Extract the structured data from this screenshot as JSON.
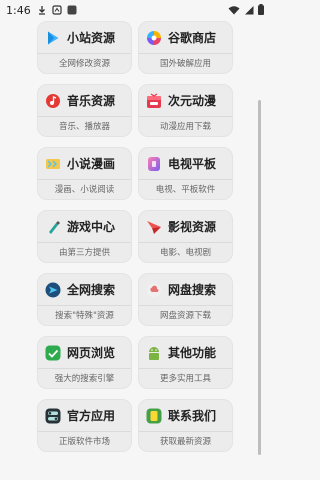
{
  "status_bar": {
    "time": "1:46"
  },
  "cards": [
    {
      "title": "小站资源",
      "sub": "全网修改资源",
      "icon": "play-store-icon",
      "color": "#3fb2ff"
    },
    {
      "title": "谷歌商店",
      "sub": "国外破解应用",
      "icon": "pinwheel-icon",
      "color": "#f0a030"
    },
    {
      "title": "音乐资源",
      "sub": "音乐、播放器",
      "icon": "music-note-icon",
      "color": "#e53935"
    },
    {
      "title": "次元动漫",
      "sub": "动漫应用下载",
      "icon": "gift-box-icon",
      "color": "#e53950"
    },
    {
      "title": "小说漫画",
      "sub": "漫画、小说阅读",
      "icon": "book-icon",
      "color": "#f2c94c"
    },
    {
      "title": "电视平板",
      "sub": "电视、平板软件",
      "icon": "tablet-icon",
      "color": "#9b6cf0"
    },
    {
      "title": "游戏中心",
      "sub": "由第三方提供",
      "icon": "gamepad-icon",
      "color": "#26a69a"
    },
    {
      "title": "影视资源",
      "sub": "电影、电视剧",
      "icon": "paper-plane-icon",
      "color": "#ef5350"
    },
    {
      "title": "全网搜索",
      "sub": "搜索\"特殊\"资源",
      "icon": "search-arrow-icon",
      "color": "#1e88c8"
    },
    {
      "title": "网盘搜索",
      "sub": "网盘资源下载",
      "icon": "cloud-drive-icon",
      "color": "#e57373"
    },
    {
      "title": "网页浏览",
      "sub": "强大的搜索引擎",
      "icon": "check-browser-icon",
      "color": "#2eaa4f"
    },
    {
      "title": "其他功能",
      "sub": "更多实用工具",
      "icon": "android-icon",
      "color": "#7cb342"
    },
    {
      "title": "官方应用",
      "sub": "正版软件市场",
      "icon": "toggle-app-icon",
      "color": "#263238"
    },
    {
      "title": "联系我们",
      "sub": "获取最新资源",
      "icon": "contact-phone-icon",
      "color": "#43a047"
    }
  ]
}
